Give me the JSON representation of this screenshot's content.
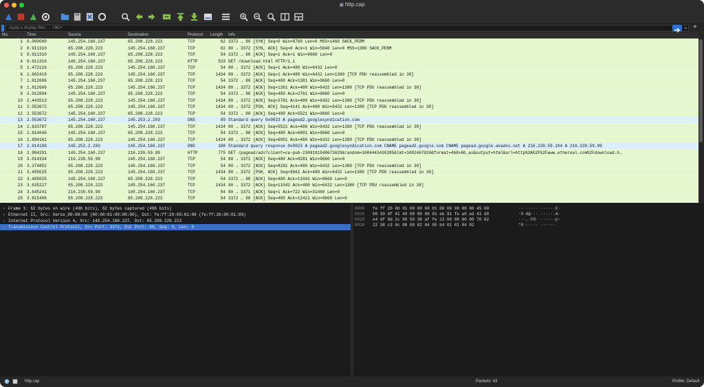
{
  "window": {
    "title": "http.cap"
  },
  "filter": {
    "placeholder": "Apply a display filter … <⌘/>"
  },
  "columns": [
    "No.",
    "Time",
    "Source",
    "Destination",
    "Protocol",
    "Length",
    "Info"
  ],
  "packets": [
    {
      "no": "1",
      "time": "0.000000",
      "src": "145.254.160.237",
      "dst": "65.208.228.223",
      "proto": "TCP",
      "len": "62",
      "info": "3372 → 80 [SYN] Seq=0 Win=8760 Len=0 MSS=1460 SACK_PERM"
    },
    {
      "no": "2",
      "time": "0.911310",
      "src": "65.208.228.223",
      "dst": "145.254.160.237",
      "proto": "TCP",
      "len": "62",
      "info": "80 → 3372 [SYN, ACK] Seq=0 Ack=1 Win=5840 Len=0 MSS=1380 SACK_PERM"
    },
    {
      "no": "3",
      "time": "0.911310",
      "src": "145.254.160.237",
      "dst": "65.208.228.223",
      "proto": "TCP",
      "len": "54",
      "info": "3372 → 80 [ACK] Seq=1 Ack=1 Win=9660 Len=0"
    },
    {
      "no": "4",
      "time": "0.911310",
      "src": "145.254.160.237",
      "dst": "65.208.228.223",
      "proto": "HTTP",
      "len": "533",
      "info": "GET /download.html HTTP/1.1"
    },
    {
      "no": "5",
      "time": "1.472116",
      "src": "65.208.228.223",
      "dst": "145.254.160.237",
      "proto": "TCP",
      "len": "54",
      "info": "80 → 3372 [ACK] Seq=1 Ack=480 Win=6432 Len=0"
    },
    {
      "no": "6",
      "time": "1.682419",
      "src": "65.208.228.223",
      "dst": "145.254.160.237",
      "proto": "TCP",
      "len": "1434",
      "info": "80 → 3372 [ACK] Seq=1 Ack=480 Win=6432 Len=1380 [TCP PDU reassembled in 38]"
    },
    {
      "no": "7",
      "time": "1.812606",
      "src": "145.254.160.237",
      "dst": "65.208.228.223",
      "proto": "TCP",
      "len": "54",
      "info": "3372 → 80 [ACK] Seq=480 Ack=1381 Win=9660 Len=0"
    },
    {
      "no": "8",
      "time": "1.812606",
      "src": "65.208.228.223",
      "dst": "145.254.160.237",
      "proto": "TCP",
      "len": "1434",
      "info": "80 → 3372 [ACK] Seq=1381 Ack=480 Win=6432 Len=1380 [TCP PDU reassembled in 38]"
    },
    {
      "no": "9",
      "time": "2.012894",
      "src": "145.254.160.237",
      "dst": "65.208.228.223",
      "proto": "TCP",
      "len": "54",
      "info": "3372 → 80 [ACK] Seq=480 Ack=2761 Win=9660 Len=0"
    },
    {
      "no": "10",
      "time": "2.443513",
      "src": "65.208.228.223",
      "dst": "145.254.160.237",
      "proto": "TCP",
      "len": "1434",
      "info": "80 → 3372 [ACK] Seq=2761 Ack=480 Win=6432 Len=1380 [TCP PDU reassembled in 38]"
    },
    {
      "no": "11",
      "time": "2.553672",
      "src": "65.208.228.223",
      "dst": "145.254.160.237",
      "proto": "TCP",
      "len": "1434",
      "info": "80 → 3372 [PSH, ACK] Seq=4141 Ack=480 Win=6432 Len=1380 [TCP PDU reassembled in 38]"
    },
    {
      "no": "12",
      "time": "2.553672",
      "src": "145.254.160.237",
      "dst": "65.208.228.223",
      "proto": "TCP",
      "len": "54",
      "info": "3372 → 80 [ACK] Seq=480 Ack=5521 Win=9660 Len=0"
    },
    {
      "no": "13",
      "time": "2.553672",
      "src": "145.254.160.237",
      "dst": "145.253.2.203",
      "proto": "DNS",
      "len": "89",
      "info": "Standard query 0x0023 A pagead2.googlesyndication.com",
      "kind": "dns"
    },
    {
      "no": "14",
      "time": "2.633787",
      "src": "65.208.228.223",
      "dst": "145.254.160.237",
      "proto": "TCP",
      "len": "1434",
      "info": "80 → 3372 [ACK] Seq=5521 Ack=480 Win=6432 Len=1380 [TCP PDU reassembled in 38]"
    },
    {
      "no": "15",
      "time": "2.814046",
      "src": "145.254.160.237",
      "dst": "65.208.228.223",
      "proto": "TCP",
      "len": "54",
      "info": "3372 → 80 [ACK] Seq=480 Ack=6901 Win=9660 Len=0"
    },
    {
      "no": "16",
      "time": "2.894161",
      "src": "65.208.228.223",
      "dst": "145.254.160.237",
      "proto": "TCP",
      "len": "1434",
      "info": "80 → 3372 [ACK] Seq=6901 Ack=480 Win=6432 Len=1380 [TCP PDU reassembled in 38]"
    },
    {
      "no": "17",
      "time": "2.914190",
      "src": "145.253.2.203",
      "dst": "145.254.160.237",
      "proto": "DNS",
      "len": "188",
      "info": "Standard query response 0x0023 A pagead2.googlesyndication.com CNAME pagead2.google.com CNAME pagead.google.akadns.net A 216.239.59.104 A 216.239.59.99",
      "kind": "dns"
    },
    {
      "no": "18",
      "time": "2.984291",
      "src": "145.254.160.237",
      "dst": "216.239.59.99",
      "proto": "HTTP",
      "len": "775",
      "info": "GET /pagead/ads?client=ca-pub-2309191948673629&random=1084443430285&lmt=1082467020&format=468x60_as&output=html&url=http%3A%2F%2Fwww.ethereal.com%2Fdownload.h…"
    },
    {
      "no": "19",
      "time": "3.014334",
      "src": "216.239.59.99",
      "dst": "145.254.160.237",
      "proto": "TCP",
      "len": "54",
      "info": "80 → 3372 [ACK] Seq=480 Ack=8281 Win=9660 Len=0"
    },
    {
      "no": "20",
      "time": "3.374852",
      "src": "65.208.228.223",
      "dst": "145.254.160.237",
      "proto": "TCP",
      "len": "54",
      "info": "80 → 3372 [ACK] Seq=8281 Ack=480 Win=6432 Len=1380 [TCP PDU reassembled in 38]"
    },
    {
      "no": "21",
      "time": "3.495025",
      "src": "65.208.228.223",
      "dst": "145.254.160.237",
      "proto": "TCP",
      "len": "1434",
      "info": "80 → 3372 [PSH, ACK] Seq=9661 Ack=480 Win=6432 Len=1380 [TCP PDU reassembled in 38]"
    },
    {
      "no": "22",
      "time": "3.495025",
      "src": "145.254.160.237",
      "dst": "65.208.228.223",
      "proto": "TCP",
      "len": "54",
      "info": "3372 → 80 [ACK] Seq=480 Ack=11041 Win=9660 Len=0"
    },
    {
      "no": "23",
      "time": "3.635227",
      "src": "65.208.228.223",
      "dst": "145.254.160.237",
      "proto": "TCP",
      "len": "1434",
      "info": "80 → 3372 [ACK] Seq=11041 Ack=480 Win=6432 Len=1380 [TCP PDU reassembled in 38]"
    },
    {
      "no": "24",
      "time": "3.645241",
      "src": "216.239.59.99",
      "dst": "145.254.160.237",
      "proto": "TCP",
      "len": "54",
      "info": "80 → 3371 [ACK] Seq=1 Ack=722 Win=31460 Len=0"
    },
    {
      "no": "25",
      "time": "3.815486",
      "src": "65.208.228.223",
      "dst": "65.208.228.223",
      "proto": "TCP",
      "len": "54",
      "info": "3372 → 80 [ACK] Seq=480 Ack=12421 Win=9660 Len=0"
    }
  ],
  "details": [
    "Frame 1: 62 bytes on wire (496 bits), 62 bytes captured (496 bits)",
    "Ethernet II, Src: Xerox_00:00:00 (00:00:01:00:00:00), Dst: fe:ff:20:00:01:00 (fe:ff:20:00:01:00)",
    "Internet Protocol Version 4, Src: 145.254.160.237, Dst: 65.208.228.223",
    "Transmission Control Protocol, Src Port: 3372, Dst Port: 80, Seq: 0, Len: 0"
  ],
  "hex": [
    {
      "offset": "0000",
      "bytes": "fe ff 20 00 01 00 00 00  01 00 00 00 08 00 45 00",
      "ascii": "·· ····· ······E·"
    },
    {
      "offset": "0010",
      "bytes": "00 30 0f 41 40 00 80 06  91 eb 91 fe a0 ed 41 d0",
      "ascii": "·0·A@··· ······A·"
    },
    {
      "offset": "0020",
      "bytes": "e4 df 0d 2c 00 50 38 af  fe 13 00 00 00 00 70 02",
      "ascii": "···,·P8· ······p·"
    },
    {
      "offset": "0030",
      "bytes": "22 38 c3 0c 00 00 02 04  05 b4 01 01 04 02",
      "ascii": "\"8······ ······"
    }
  ],
  "status": {
    "file": "http.cap",
    "packets": "Packets: 43",
    "profile": "Profile: Default"
  },
  "colors": {
    "tcp_row": "#e4f7cf",
    "dns_row": "#daeefe",
    "selected": "#3b6ec6"
  }
}
